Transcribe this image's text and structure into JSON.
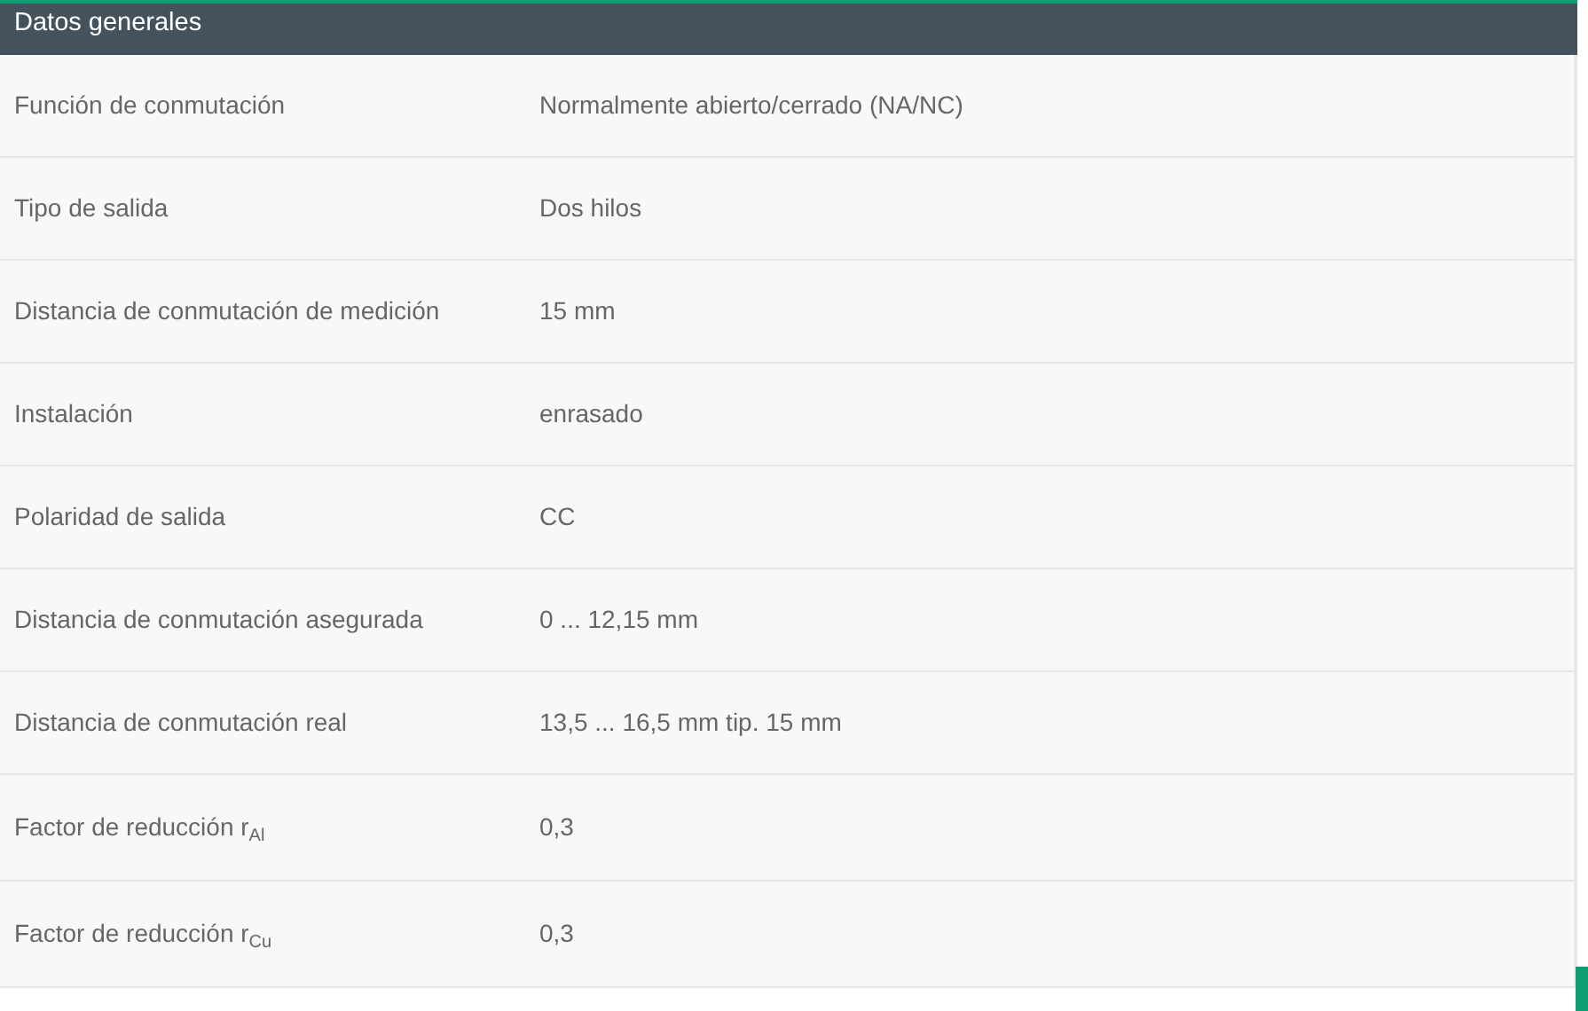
{
  "section": {
    "title": "Datos generales"
  },
  "rows": [
    {
      "label": "Función de conmutación",
      "value": "Normalmente abierto/cerrado (NA/NC)"
    },
    {
      "label": "Tipo de salida",
      "value": "Dos hilos"
    },
    {
      "label": "Distancia de conmutación de medición",
      "value": "15 mm"
    },
    {
      "label": "Instalación",
      "value": "enrasado"
    },
    {
      "label": "Polaridad de salida",
      "value": "CC"
    },
    {
      "label": "Distancia de conmutación asegurada",
      "value": "0 ... 12,15 mm"
    },
    {
      "label": "Distancia de conmutación real",
      "value": "13,5 ... 16,5 mm tip. 15 mm"
    },
    {
      "label": "Factor de reducción r$_{Al}$",
      "value": "0,3"
    },
    {
      "label": "Factor de reducción r$_{Cu}$",
      "value": "0,3"
    }
  ]
}
